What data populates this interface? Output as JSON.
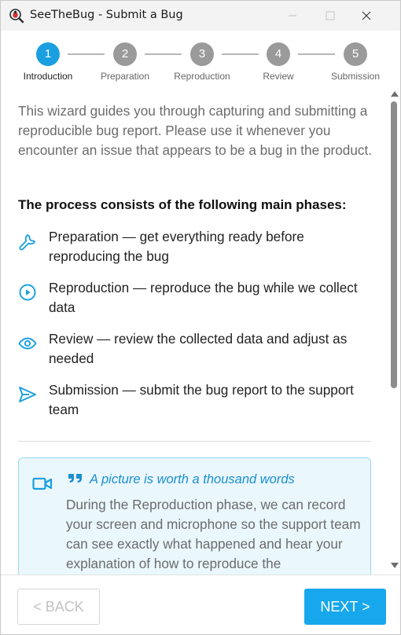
{
  "window": {
    "title": "SeeTheBug - Submit a Bug"
  },
  "stepper": {
    "steps": [
      {
        "number": "1",
        "label": "Introduction",
        "active": true
      },
      {
        "number": "2",
        "label": "Preparation",
        "active": false
      },
      {
        "number": "3",
        "label": "Reproduction",
        "active": false
      },
      {
        "number": "4",
        "label": "Review",
        "active": false
      },
      {
        "number": "5",
        "label": "Submission",
        "active": false
      }
    ]
  },
  "content": {
    "intro": "This wizard guides you through capturing and submitting a reproducible bug report. Please use it whenever you encounter an issue that appears to be a bug in the product.",
    "phase_heading": "The process consists of the following main phases:",
    "phases": [
      {
        "icon": "wrench-icon",
        "text": "Preparation — get everything ready before reproducing the bug"
      },
      {
        "icon": "play-circle-icon",
        "text": "Reproduction — reproduce the bug while we collect data"
      },
      {
        "icon": "eye-icon",
        "text": "Review — review the collected data and adjust as needed"
      },
      {
        "icon": "send-icon",
        "text": "Submission — submit the bug report to the support team"
      }
    ],
    "callout": {
      "icon": "video-camera-icon",
      "title": "A picture is worth a thousand words",
      "body": "During the Reproduction phase, we can record your screen and microphone so the support team can see exactly what happened and hear your explanation of how to reproduce the"
    }
  },
  "footer": {
    "back_label": "< BACK",
    "next_label": "NEXT >"
  },
  "colors": {
    "accent": "#1a9fe0",
    "next_button": "#17a7ec",
    "callout_bg": "#eaf7fd",
    "callout_title": "#1a8fcf"
  }
}
